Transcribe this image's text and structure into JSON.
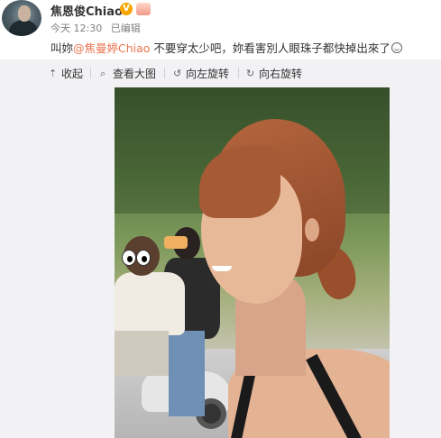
{
  "post": {
    "author": "焦恩俊Chiao",
    "verified_badge": "V",
    "time": "今天 12:30",
    "edited": "已编辑",
    "text_prefix": "叫妳",
    "mention": "@焦曼婷Chiao",
    "text_suffix": " 不要穿太少吧，妳看害別人眼珠子都快掉出來了",
    "emoji": "smile"
  },
  "toolbar": {
    "collapse": "收起",
    "view_large": "查看大图",
    "rotate_left": "向左旋转",
    "rotate_right": "向右旋转"
  },
  "colors": {
    "mention": "#eb7350",
    "verified": "#f7a600",
    "panel": "#f2f2f5"
  },
  "icons": [
    "collapse-icon",
    "zoom-icon",
    "rotate-left-icon",
    "rotate-right-icon",
    "smile-icon",
    "verified-icon"
  ]
}
